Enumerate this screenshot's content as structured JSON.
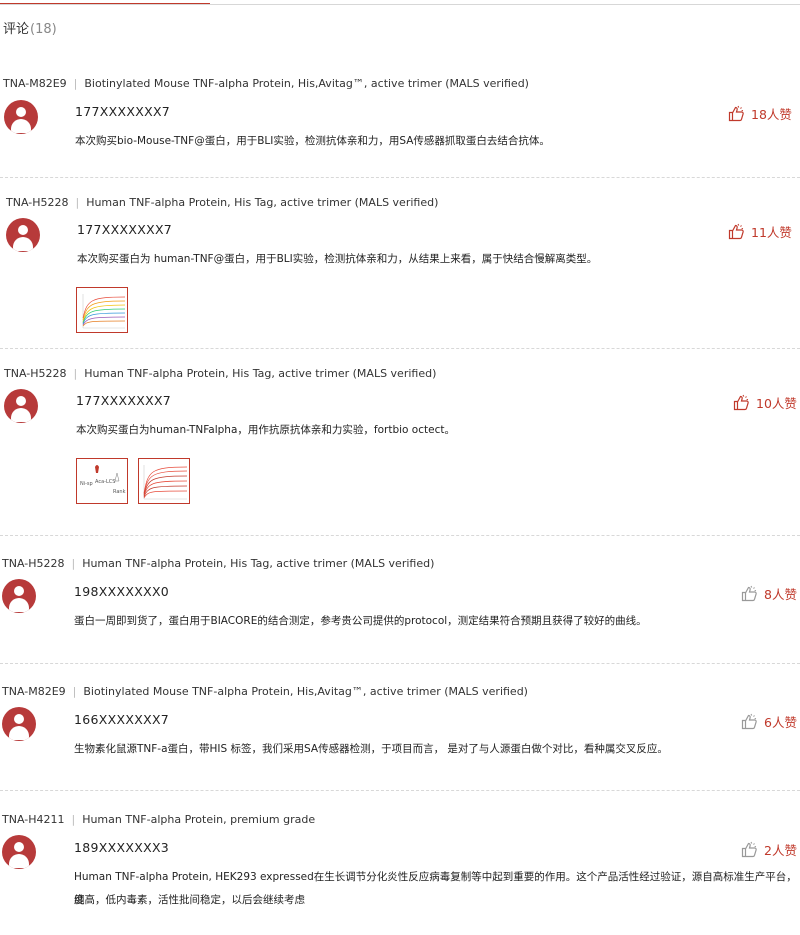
{
  "header": {
    "title": "评论",
    "count": "(18)"
  },
  "reviews": [
    {
      "code": "TNA-M82E9",
      "product": "Biotinylated Mouse TNF-alpha Protein, His,Avitag™, active trimer (MALS verified)",
      "user": "177XXXXXXX7",
      "text": "本次购买bio-Mouse-TNF@蛋白，用于BLI实验，检测抗体亲和力，用SA传感器抓取蛋白去结合抗体。",
      "likes": "18人赞"
    },
    {
      "code": "TNA-H5228",
      "product": "Human TNF-alpha Protein, His Tag, active trimer (MALS verified)",
      "user": "177XXXXXXX7",
      "text": "本次购买蛋白为 human-TNF@蛋白，用于BLI实验，检测抗体亲和力，从结果上来看，属于快结合慢解离类型。",
      "likes": "11人赞"
    },
    {
      "code": "TNA-H5228",
      "product": "Human TNF-alpha Protein, His Tag, active trimer (MALS verified)",
      "user": "177XXXXXXX7",
      "text": "本次购买蛋白为human-TNFalpha，用作抗原抗体亲和力实验，fortbio octect。",
      "likes": "10人赞"
    },
    {
      "code": "TNA-H5228",
      "product": "Human TNF-alpha Protein, His Tag, active trimer (MALS verified)",
      "user": "198XXXXXXX0",
      "text": "蛋白一周即到货了，蛋白用于BIACORE的结合测定，参考贵公司提供的protocol，测定结果符合预期且获得了较好的曲线。",
      "likes": "8人赞"
    },
    {
      "code": "TNA-M82E9",
      "product": "Biotinylated Mouse TNF-alpha Protein, His,Avitag™, active trimer (MALS verified)",
      "user": "166XXXXXXX7",
      "text": "生物素化鼠源TNF-a蛋白，带HIS 标签，我们采用SA传感器检测，于项目而言， 是对了与人源蛋白做个对比，看种属交叉反应。",
      "likes": "6人赞"
    },
    {
      "code": "TNA-H4211",
      "product": "Human TNF-alpha Protein, premium grade",
      "user": "189XXXXXXX3",
      "text1": "Human TNF-alpha Protein, HEK293 expressed在生长调节分化炎性反应病毒复制等中起到重要的作用。这个产品活性经过验证，源自高标准生产平台，纯",
      "text2": "度高，低内毒素，活性批间稳定，以后会继续考虑",
      "likes": "2人赞"
    }
  ],
  "thumb_labels": {
    "a1": "Ni-sp",
    "a2": "Aca-LCS",
    "a3": "Rank"
  }
}
